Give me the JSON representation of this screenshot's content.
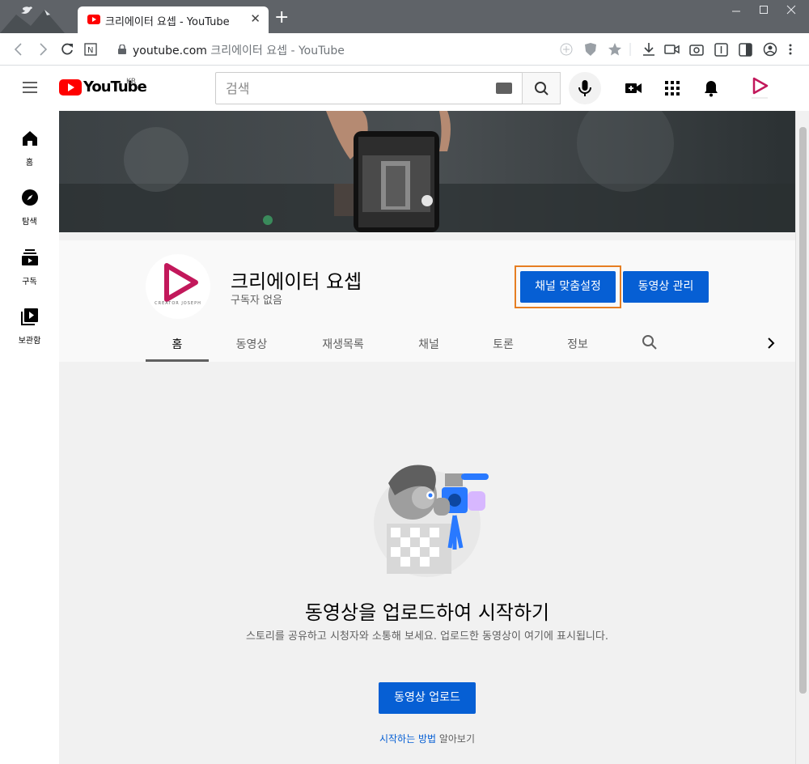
{
  "browser": {
    "tab_title": "크리에이터 요셉 - YouTube",
    "tab_close": "✕",
    "new_tab": "+",
    "url_domain": "youtube.com",
    "url_rest": "크리에이터 요셉 - YouTube"
  },
  "header": {
    "logo_text": "YouTube",
    "region": "KR",
    "search_placeholder": "검색"
  },
  "sidebar": {
    "items": [
      {
        "label": "홈",
        "icon": "home-icon"
      },
      {
        "label": "탐색",
        "icon": "compass-icon"
      },
      {
        "label": "구독",
        "icon": "subscriptions-icon"
      },
      {
        "label": "보관함",
        "icon": "library-icon"
      }
    ]
  },
  "channel": {
    "name": "크리에이터 요셉",
    "subscribers": "구독자 없음",
    "avatar_caption": "CREATOR JOSEPH",
    "customize_label": "채널 맞춤설정",
    "manage_label": "동영상 관리"
  },
  "tabs": [
    "홈",
    "동영상",
    "재생목록",
    "채널",
    "토론",
    "정보"
  ],
  "empty_state": {
    "title": "동영상을 업로드하여 시작하기",
    "description": "스토리를 공유하고 시청자와 소통해 보세요. 업로드한 동영상이 여기에 표시됩니다.",
    "upload_label": "동영상 업로드",
    "learn_link": "시작하는 방법",
    "learn_suffix": " 알아보기"
  },
  "colors": {
    "accent": "#065fd4",
    "youtube_red": "#ff0000",
    "focus_ring": "#e67e22",
    "avatar_brand": "#c2185b"
  }
}
